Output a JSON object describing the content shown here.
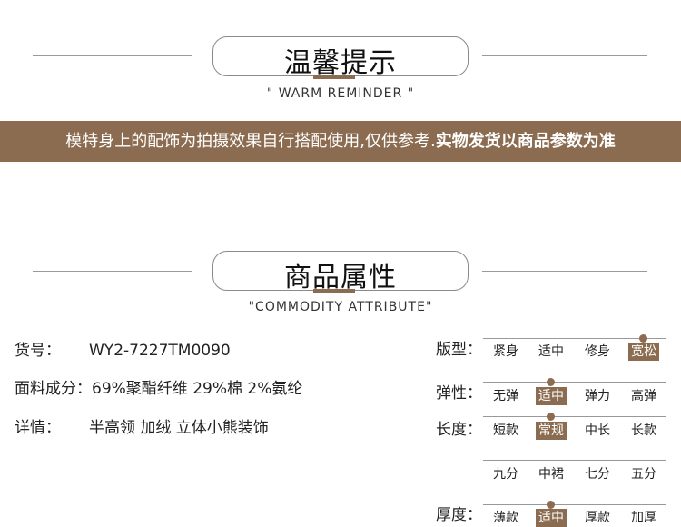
{
  "reminder": {
    "title": "温馨提示",
    "subtitle": "\" WARM REMINDER \"",
    "banner_normal": "模特身上的配饰为拍摄效果自行搭配使用,仅供参考.",
    "banner_bold": "实物发货以商品参数为准"
  },
  "attributes": {
    "title": "商品属性",
    "subtitle": "\"COMMODITY ATTRIBUTE\"",
    "rows": [
      {
        "label": "货号：",
        "value": "WY2-7227TM0090"
      },
      {
        "label": "面料成分：",
        "value": "69%聚酯纤维 29%棉 2%氨纶"
      },
      {
        "label": "详情：",
        "value": "半高领 加绒 立体小熊装饰"
      }
    ]
  },
  "gauges": {
    "fit": {
      "label": "版型：",
      "options": [
        "紧身",
        "适中",
        "修身",
        "宽松"
      ],
      "selected": "宽松"
    },
    "elastic": {
      "label": "弹性：",
      "options": [
        "无弹",
        "适中",
        "弹力",
        "高弹"
      ],
      "selected": "适中"
    },
    "length": {
      "label": "长度：",
      "options": [
        "短款",
        "常规",
        "中长",
        "长款"
      ],
      "options2": [
        "九分",
        "中裙",
        "七分",
        "五分"
      ],
      "selected": "常规"
    },
    "thickness": {
      "label": "厚度：",
      "options": [
        "薄款",
        "适中",
        "厚款",
        "加厚"
      ],
      "selected": "适中"
    }
  },
  "colors": {
    "accent": "#8b6c50"
  }
}
